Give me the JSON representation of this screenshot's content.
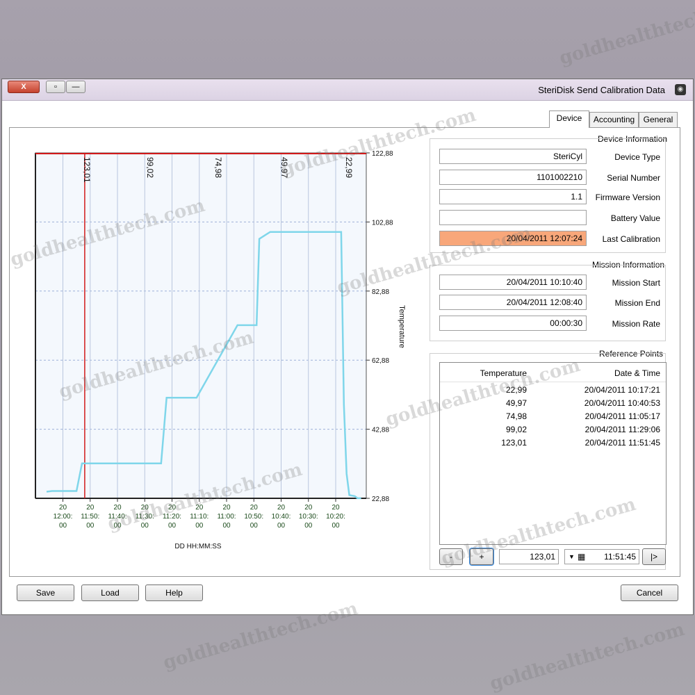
{
  "window": {
    "title": "SteriDisk Send Calibration Data",
    "controls": {
      "close": "X",
      "maximize": "▫",
      "minimize": "—"
    }
  },
  "tabs": [
    {
      "label": "General"
    },
    {
      "label": "Accounting"
    },
    {
      "label": "Device"
    }
  ],
  "device_info": {
    "title": "Device Information",
    "rows": [
      {
        "label": "Device Type",
        "value": "SteriCyl"
      },
      {
        "label": "Serial Number",
        "value": "1101002210"
      },
      {
        "label": "Firmware Version",
        "value": "1.1"
      },
      {
        "label": "Battery Value",
        "value": ""
      },
      {
        "label": "Last Calibration",
        "value": "20/04/2011 12:07:24"
      }
    ]
  },
  "mission_info": {
    "title": "Mission Information",
    "rows": [
      {
        "label": "Mission Start",
        "value": "20/04/2011 10:10:40"
      },
      {
        "label": "Mission End",
        "value": "20/04/2011 12:08:40"
      },
      {
        "label": "Mission Rate",
        "value": "00:00:30"
      }
    ]
  },
  "reference_points": {
    "title": "Reference Points",
    "columns": [
      "Date & Time",
      "Temperature"
    ],
    "rows": [
      [
        "20/04/2011 10:17:21",
        "22,99"
      ],
      [
        "20/04/2011 10:40:53",
        "49,97"
      ],
      [
        "20/04/2011 11:05:17",
        "74,98"
      ],
      [
        "20/04/2011 11:29:06",
        "99,02"
      ],
      [
        "20/04/2011 11:51:45",
        "123,01"
      ]
    ],
    "controls": {
      "nav_label": "|>",
      "time_value": "11:51:45",
      "temp_value": "123,01",
      "add_label": "+",
      "remove_label": "-"
    }
  },
  "buttons": {
    "save": "Save",
    "load": "Load",
    "help": "Help",
    "cancel": "Cancel"
  },
  "chart_data": {
    "type": "line",
    "ylabel": "Temperature",
    "xlabel": "DD HH:MM:SS",
    "ylim": [
      22.88,
      122.88
    ],
    "yticks": [
      "22,88",
      "42,88",
      "62,88",
      "82,88",
      "102,88",
      "122,88"
    ],
    "xticks": [
      "20 10:20:00",
      "20 10:30:00",
      "20 10:40:00",
      "20 10:50:00",
      "20 11:00:00",
      "20 11:10:00",
      "20 11:20:00",
      "20 11:30:00",
      "20 11:40:00",
      "20 11:50:00",
      "20 12:00:00"
    ],
    "reference_labels": [
      "22,99",
      "49,97",
      "74,98",
      "99,02",
      "123,01"
    ],
    "series": [
      {
        "color": "#7fd6ea",
        "x_minutes_after_10": [
          10.67,
          12,
          13,
          15,
          16,
          17,
          18,
          30,
          31,
          44,
          48,
          49,
          55,
          56,
          71,
          74,
          75,
          82,
          84,
          94,
          98,
          102,
          113,
          115,
          124,
          126
        ],
        "values": [
          22.9,
          22.9,
          23.5,
          23.8,
          30,
          50,
          100,
          100,
          100,
          100,
          98,
          73,
          73,
          73,
          52,
          52,
          52,
          52,
          33,
          33,
          33,
          33,
          33,
          25,
          25,
          24.8
        ]
      }
    ],
    "grid": true,
    "background": "#f4f8fd",
    "limit_line_color": "#d21919"
  },
  "watermark_text": "goldhealthtech.com"
}
